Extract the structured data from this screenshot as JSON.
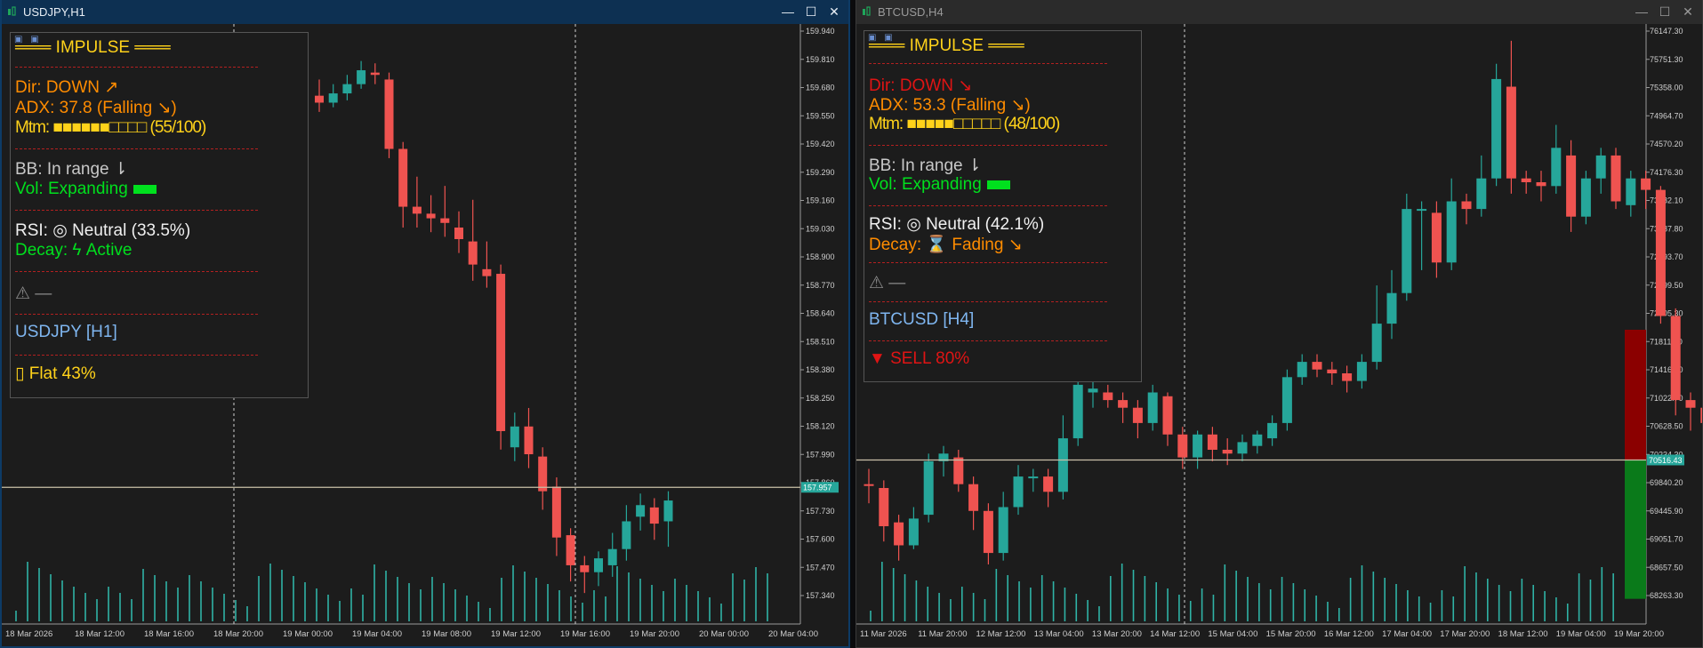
{
  "windows": [
    {
      "id": "left",
      "title": "USDJPY,H1",
      "controls": {
        "minimize": "—",
        "maximize": "☐",
        "close": "✕"
      },
      "panel": {
        "title": "═══ IMPULSE ═══",
        "dir": "Dir: DOWN ↗",
        "adx": "ADX: 37.8 (Falling ↘)",
        "mtm": "Mtm: ■■■■■■□□□□ (55/100)",
        "bb": "BB: In range ⇂",
        "vol": "Vol: Expanding",
        "rsi": "RSI: ◎ Neutral (33.5%)",
        "decay": "Decay: ϟ Active",
        "warning": "⚠ —",
        "symbol": "USDJPY [H1]",
        "signal": "▯ Flat 43%"
      },
      "colors": {
        "dir": "#ff8c00",
        "adx": "#ff8c00",
        "mtm": "#ffd21a",
        "decay": "#00e01e",
        "signal": "#ffd21a"
      },
      "chart_data": {
        "type": "candlestick",
        "yticks": [
          "159.940",
          "159.810",
          "159.680",
          "159.550",
          "159.420",
          "159.290",
          "159.160",
          "159.030",
          "158.900",
          "158.770",
          "158.640",
          "158.510",
          "158.380",
          "158.250",
          "158.120",
          "157.990",
          "157.860",
          "157.730",
          "157.600",
          "157.470",
          "157.340"
        ],
        "xticks": [
          "18 Mar 2026",
          "18 Mar 12:00",
          "18 Mar 16:00",
          "18 Mar 20:00",
          "19 Mar 00:00",
          "19 Mar 04:00",
          "19 Mar 08:00",
          "19 Mar 12:00",
          "19 Mar 16:00",
          "19 Mar 20:00",
          "20 Mar 00:00",
          "20 Mar 04:00"
        ],
        "ylim": [
          157.27,
          159.96
        ],
        "price_label": "157.957",
        "price_line": 157.957,
        "candle_start_index": 22,
        "candles": [
          [
            159.65,
            159.62,
            159.72,
            159.58
          ],
          [
            159.62,
            159.66,
            159.7,
            159.6
          ],
          [
            159.66,
            159.7,
            159.74,
            159.63
          ],
          [
            159.7,
            159.76,
            159.8,
            159.68
          ],
          [
            159.75,
            159.74,
            159.79,
            159.7
          ],
          [
            159.72,
            159.42,
            159.75,
            159.38
          ],
          [
            159.42,
            159.17,
            159.45,
            159.08
          ],
          [
            159.17,
            159.14,
            159.3,
            159.08
          ],
          [
            159.14,
            159.12,
            159.22,
            159.06
          ],
          [
            159.12,
            159.1,
            159.26,
            159.04
          ],
          [
            159.08,
            159.03,
            159.15,
            158.97
          ],
          [
            159.02,
            158.92,
            159.2,
            158.85
          ],
          [
            158.9,
            158.87,
            159.02,
            158.82
          ],
          [
            158.88,
            158.2,
            158.92,
            158.12
          ],
          [
            158.13,
            158.22,
            158.28,
            158.07
          ],
          [
            158.22,
            158.1,
            158.3,
            158.04
          ],
          [
            158.09,
            157.94,
            158.13,
            157.86
          ],
          [
            157.96,
            157.74,
            158.0,
            157.66
          ],
          [
            157.75,
            157.62,
            157.78,
            157.55
          ],
          [
            157.62,
            157.59,
            157.66,
            157.5
          ],
          [
            157.59,
            157.65,
            157.68,
            157.53
          ],
          [
            157.62,
            157.69,
            157.76,
            157.57
          ],
          [
            157.69,
            157.81,
            157.88,
            157.64
          ],
          [
            157.83,
            157.88,
            157.93,
            157.77
          ],
          [
            157.87,
            157.8,
            157.91,
            157.73
          ],
          [
            157.81,
            157.9,
            157.94,
            157.7
          ]
        ],
        "volume_count": 66
      }
    },
    {
      "id": "right",
      "title": "BTCUSD,H4",
      "controls": {
        "minimize": "—",
        "maximize": "☐",
        "close": "✕"
      },
      "panel": {
        "title": "═══ IMPULSE ═══",
        "dir": "Dir: DOWN ↘",
        "adx": "ADX: 53.3 (Falling ↘)",
        "mtm": "Mtm: ■■■■■□□□□□ (48/100)",
        "bb": "BB: In range ⇂",
        "vol": "Vol: Expanding",
        "rsi": "RSI: ◎ Neutral (42.1%)",
        "decay": "Decay: ⌛ Fading ↘",
        "warning": "⚠ —",
        "symbol": "BTCUSD [H4]",
        "signal": "▼ SELL 80%"
      },
      "colors": {
        "dir": "#e01414",
        "adx": "#ff8c00",
        "mtm": "#ffd21a",
        "decay": "#ff8c00",
        "signal": "#e01414"
      },
      "chart_data": {
        "type": "candlestick",
        "yticks": [
          "76147.30",
          "75751.30",
          "75358.00",
          "74964.70",
          "74570.20",
          "74176.30",
          "73782.10",
          "73387.80",
          "72993.70",
          "72599.50",
          "72205.30",
          "71811.20",
          "71416.70",
          "71022.70",
          "70628.50",
          "70234.30",
          "69840.20",
          "69445.90",
          "69051.70",
          "68657.50",
          "68263.30"
        ],
        "xticks": [
          "11 Mar 2026",
          "11 Mar 20:00",
          "12 Mar 12:00",
          "13 Mar 04:00",
          "13 Mar 20:00",
          "14 Mar 12:00",
          "15 Mar 04:00",
          "15 Mar 20:00",
          "16 Mar 12:00",
          "17 Mar 04:00",
          "17 Mar 20:00",
          "18 Mar 12:00",
          "19 Mar 04:00",
          "19 Mar 20:00"
        ],
        "ylim": [
          68080,
          76220
        ],
        "price_label": "70516.43",
        "price_line": 70516.43,
        "candle_start_index": 0,
        "candles": [
          [
            70200,
            70180,
            70400,
            69950
          ],
          [
            70150,
            69650,
            70250,
            69450
          ],
          [
            69700,
            69400,
            69800,
            69200
          ],
          [
            69400,
            69750,
            69900,
            69350
          ],
          [
            69800,
            70500,
            70600,
            69700
          ],
          [
            70500,
            70600,
            70700,
            70300
          ],
          [
            70550,
            70200,
            70650,
            70100
          ],
          [
            70200,
            69850,
            70300,
            69600
          ],
          [
            69850,
            69300,
            69950,
            69150
          ],
          [
            69300,
            69900,
            70100,
            69200
          ],
          [
            69900,
            70300,
            70450,
            69800
          ],
          [
            70300,
            70300,
            70400,
            70100
          ],
          [
            70300,
            70100,
            70400,
            69900
          ],
          [
            70100,
            70800,
            71100,
            70000
          ],
          [
            70800,
            71500,
            71700,
            70700
          ],
          [
            71400,
            71450,
            71600,
            71200
          ],
          [
            71400,
            71300,
            71500,
            71200
          ],
          [
            71300,
            71200,
            71400,
            71000
          ],
          [
            71200,
            71000,
            71300,
            70800
          ],
          [
            71000,
            71400,
            71500,
            70900
          ],
          [
            71350,
            70850,
            71400,
            70700
          ],
          [
            70850,
            70550,
            70950,
            70400
          ],
          [
            70550,
            70850,
            70900,
            70400
          ],
          [
            70850,
            70650,
            70950,
            70500
          ],
          [
            70650,
            70600,
            70800,
            70450
          ],
          [
            70600,
            70750,
            70850,
            70500
          ],
          [
            70700,
            70850,
            70900,
            70600
          ],
          [
            70800,
            71000,
            71100,
            70700
          ],
          [
            71000,
            71600,
            71700,
            70900
          ],
          [
            71600,
            71800,
            71900,
            71500
          ],
          [
            71800,
            71700,
            71900,
            71600
          ],
          [
            71700,
            71650,
            71800,
            71500
          ],
          [
            71650,
            71550,
            71750,
            71400
          ],
          [
            71550,
            71800,
            71900,
            71450
          ],
          [
            71800,
            72300,
            72800,
            71700
          ],
          [
            72300,
            72700,
            73000,
            72100
          ],
          [
            72700,
            73800,
            74000,
            72600
          ],
          [
            73800,
            73800,
            73900,
            73000
          ],
          [
            73750,
            73100,
            73900,
            72900
          ],
          [
            73100,
            73900,
            74200,
            73000
          ],
          [
            73900,
            73800,
            74000,
            73600
          ],
          [
            73800,
            74200,
            74500,
            73700
          ],
          [
            74200,
            75500,
            75700,
            74100
          ],
          [
            75400,
            74200,
            76000,
            74000
          ],
          [
            74200,
            74150,
            74300,
            74000
          ],
          [
            74150,
            74100,
            74300,
            73900
          ],
          [
            74100,
            74600,
            74900,
            74000
          ],
          [
            74500,
            73700,
            74700,
            73500
          ],
          [
            73700,
            74200,
            74300,
            73600
          ],
          [
            74200,
            74500,
            74600,
            74000
          ],
          [
            74500,
            73900,
            74600,
            73800
          ],
          [
            73850,
            74200,
            74300,
            73700
          ],
          [
            74200,
            74050,
            74300,
            73800
          ],
          [
            74050,
            72400,
            74100,
            72300
          ],
          [
            72400,
            71300,
            72500,
            71100
          ],
          [
            71300,
            71200,
            71400,
            70900
          ],
          [
            71200,
            71000,
            71600,
            70800
          ],
          [
            71000,
            70800,
            71200,
            70600
          ],
          [
            70800,
            70600,
            70900,
            70300
          ],
          [
            70600,
            69900,
            70800,
            69700
          ],
          [
            69900,
            69300,
            70100,
            69100
          ],
          [
            69300,
            69500,
            69800,
            68900
          ],
          [
            69500,
            70300,
            70600,
            69400
          ],
          [
            70200,
            70300,
            70500,
            70000
          ],
          [
            70300,
            70000,
            70500,
            69800
          ],
          [
            70000,
            70516,
            70600,
            69900
          ]
        ],
        "band_red": [
          72220,
          70516
        ],
        "band_green": [
          70516,
          68700
        ],
        "volume_count": 66
      }
    }
  ]
}
